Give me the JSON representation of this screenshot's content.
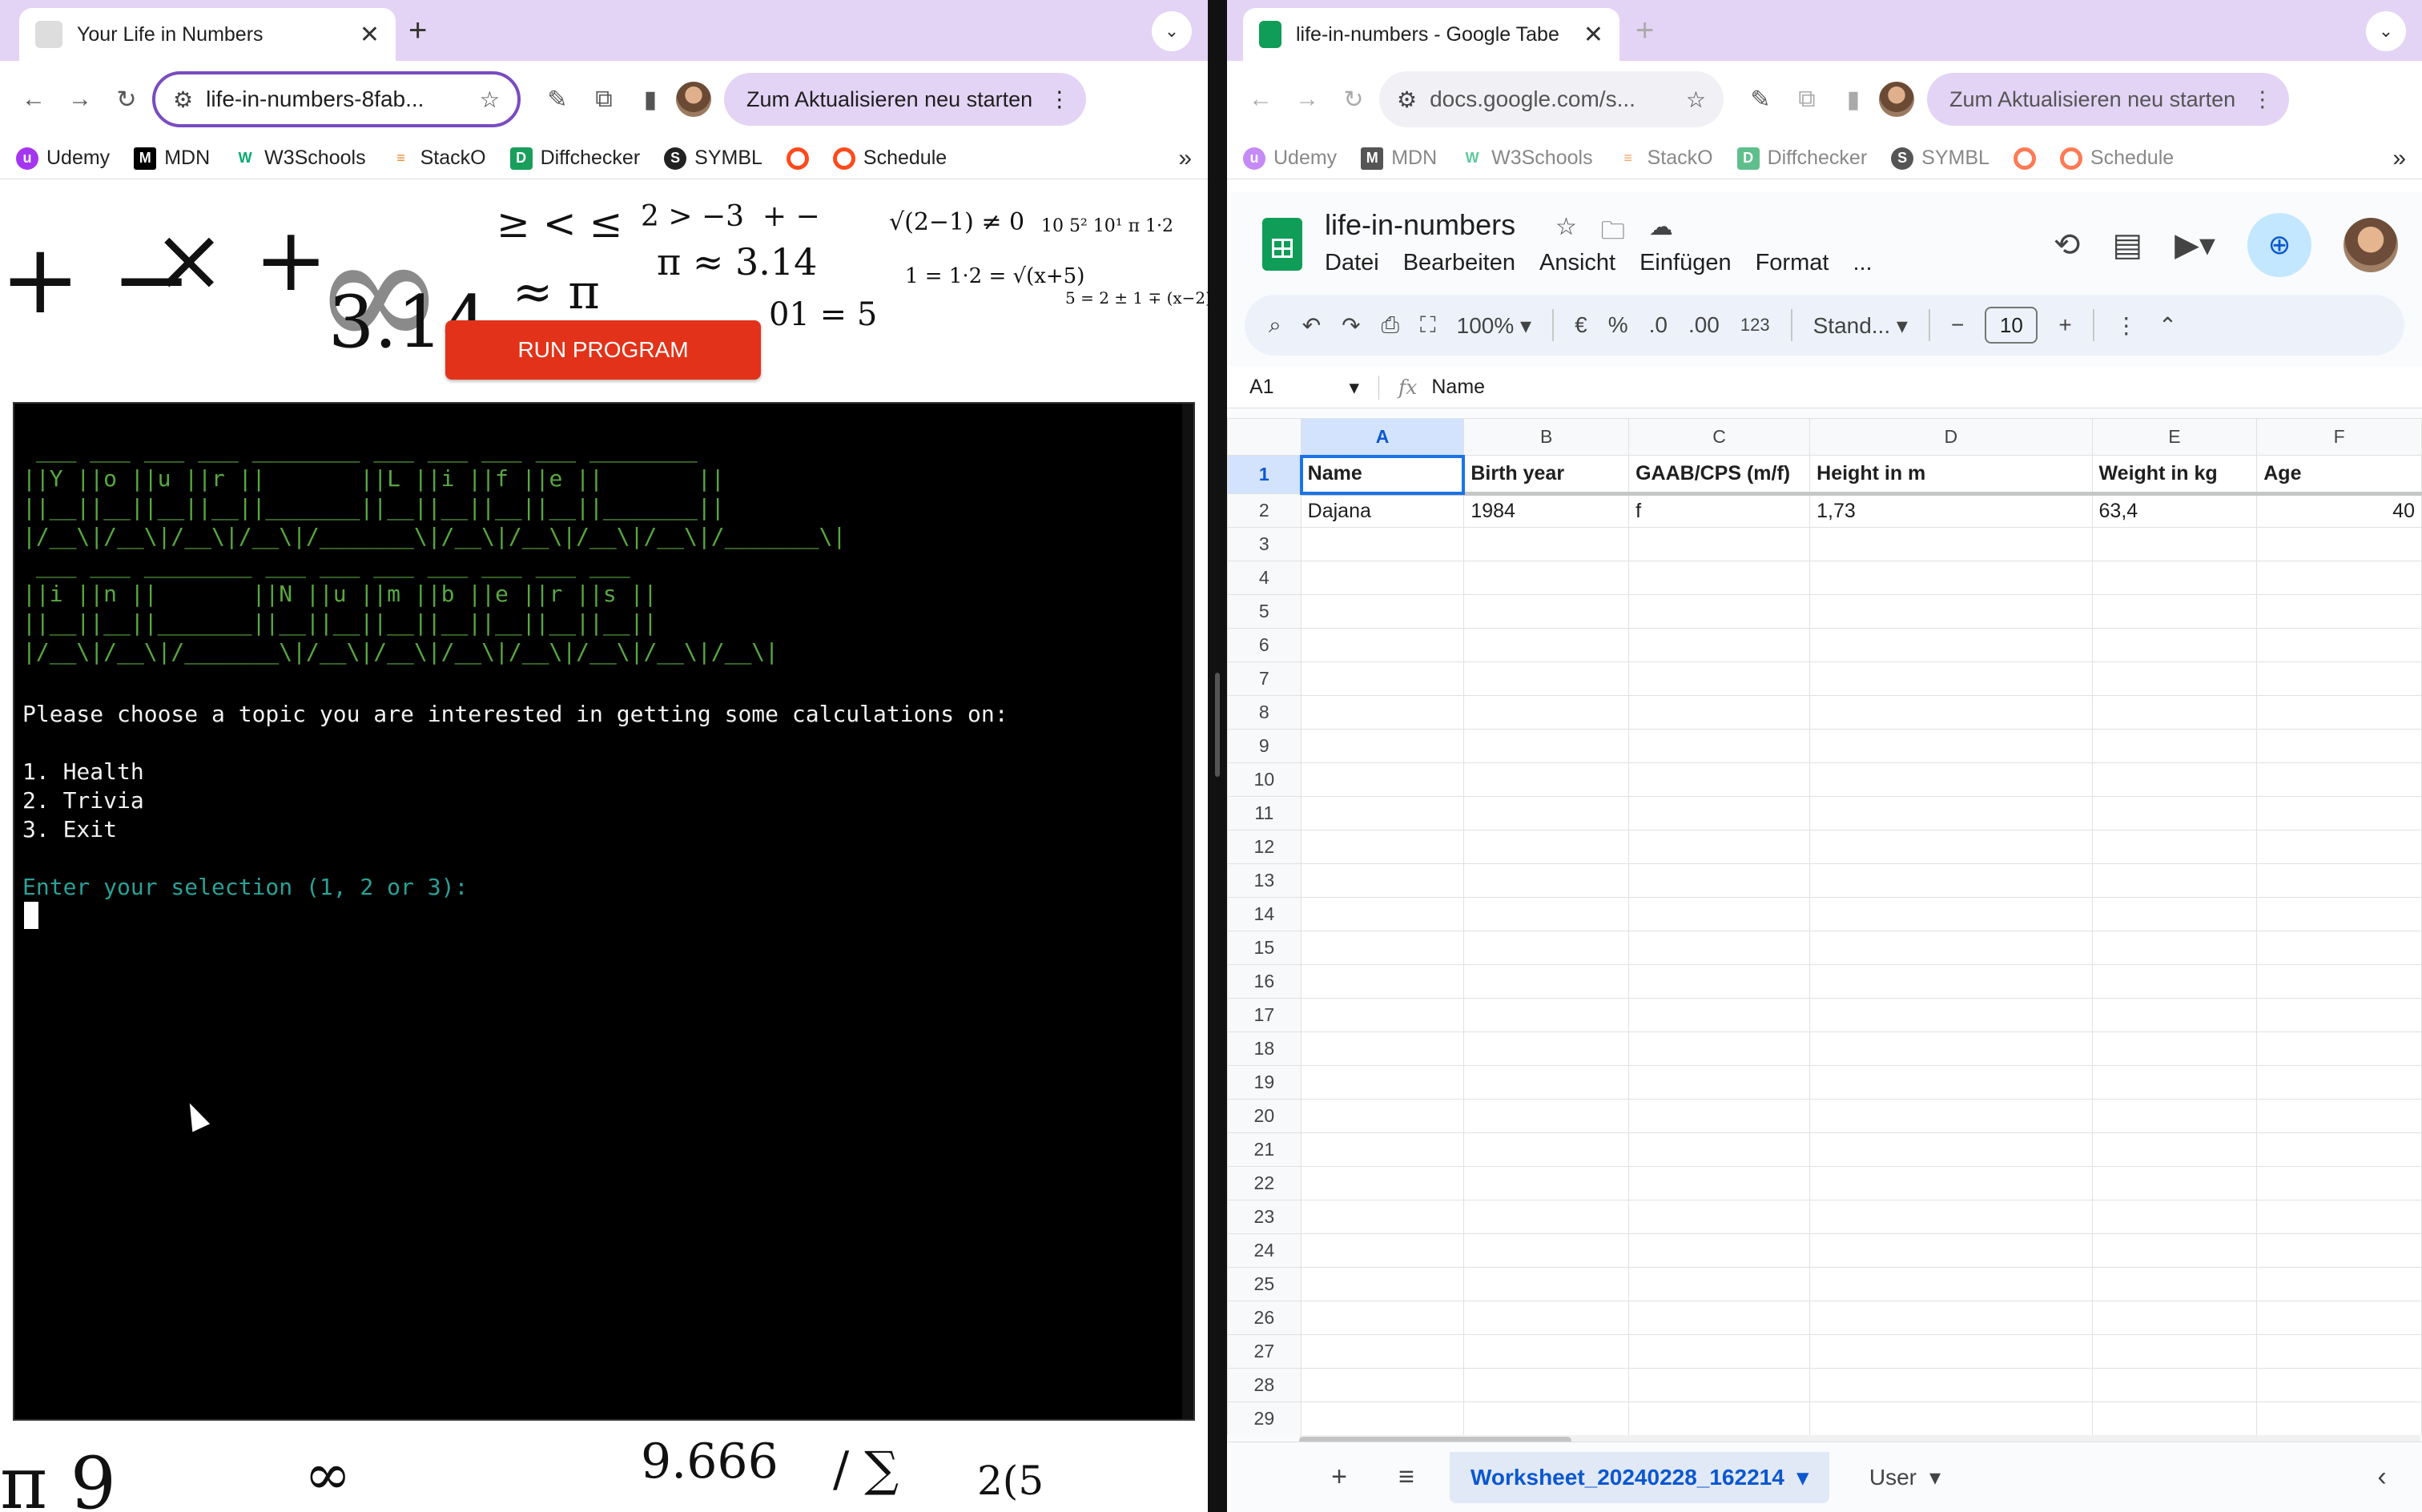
{
  "left_browser": {
    "tab_title": "Your Life in Numbers",
    "url": "life-in-numbers-8fab...",
    "update_label": "Zum Aktualisieren neu starten",
    "bookmarks": [
      "Udemy",
      "MDN",
      "W3Schools",
      "StackO",
      "Diffchecker",
      "SYMBL",
      "",
      "Schedule"
    ]
  },
  "right_browser": {
    "tab_title": "life-in-numbers - Google Tabe",
    "url": "docs.google.com/s...",
    "update_label": "Zum Aktualisieren neu starten",
    "bookmarks": [
      "Udemy",
      "MDN",
      "W3Schools",
      "StackO",
      "Diffchecker",
      "SYMBL",
      "",
      "Schedule"
    ]
  },
  "app": {
    "run_button": "RUN PROGRAM",
    "ascii_art": " ___ ___ ___ ___ ________ ___ ___ ___ ___ ________\n||Y ||o ||u ||r ||       ||L ||i ||f ||e ||       ||\n||__||__||__||__||_______||__||__||__||__||_______||\n|/__\\|/__\\|/__\\|/__\\|/_______\\|/__\\|/__\\|/__\\|/__\\|/_______\\|\n ___ ___ ________ ___ ___ ___ ___ ___ ___ ___\n||i ||n ||       ||N ||u ||m ||b ||e ||r ||s ||\n||__||__||_______||__||__||__||__||__||__||__||\n|/__\\|/__\\|/_______\\|/__\\|/__\\|/__\\|/__\\|/__\\|/__\\|/__\\|",
    "terminal_text": "Please choose a topic you are interested in getting some calculations on:\n\n1. Health\n2. Trivia\n3. Exit",
    "prompt": "Enter your selection (1, 2 or 3):"
  },
  "sheets": {
    "doc_title": "life-in-numbers",
    "menu": [
      "Datei",
      "Bearbeiten",
      "Ansicht",
      "Einfügen",
      "Format",
      "..."
    ],
    "toolbar": {
      "zoom": "100%",
      "currency": "€",
      "percent": "%",
      "dec_decrease": ".0",
      "dec_increase": ".00",
      "number_format": "123",
      "font": "Stand...",
      "font_size": "10"
    },
    "name_box": "A1",
    "formula": "Name",
    "columns": [
      "A",
      "B",
      "C",
      "D",
      "E",
      "F"
    ],
    "header_row": [
      "Name",
      "Birth year",
      "GAAB/CPS (m/f)",
      "Height in m",
      "Weight in kg",
      "Age"
    ],
    "data_row": [
      "Dajana",
      "1984",
      "f",
      "1,73",
      "63,4",
      "40"
    ],
    "row_numbers": [
      "1",
      "2",
      "3",
      "4",
      "5",
      "6",
      "7",
      "8",
      "9",
      "10",
      "11",
      "12",
      "13",
      "14",
      "15",
      "16",
      "17",
      "18",
      "19",
      "20",
      "21",
      "22",
      "23",
      "24",
      "25",
      "26",
      "27",
      "28",
      "29"
    ],
    "sheet_tabs": [
      "Worksheet_20240228_162214",
      "User"
    ]
  }
}
